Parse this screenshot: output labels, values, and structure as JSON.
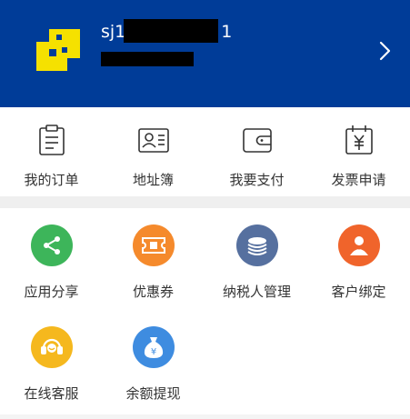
{
  "profile": {
    "username": "sj1",
    "username_suffix": "1",
    "phone": "",
    "colors": {
      "header_bg": "#003C98",
      "logo": "#F5E100"
    }
  },
  "quick_actions": [
    {
      "label": "我的订单",
      "icon": "clipboard-icon"
    },
    {
      "label": "地址簿",
      "icon": "contact-card-icon"
    },
    {
      "label": "我要支付",
      "icon": "wallet-icon"
    },
    {
      "label": "发票申请",
      "icon": "invoice-calendar-icon"
    }
  ],
  "services": [
    {
      "label": "应用分享",
      "icon": "share-icon",
      "color": "#3DB55A"
    },
    {
      "label": "优惠券",
      "icon": "coupon-icon",
      "color": "#F58A2C"
    },
    {
      "label": "纳税人管理",
      "icon": "coins-icon",
      "color": "#56709F"
    },
    {
      "label": "客户绑定",
      "icon": "user-bind-icon",
      "color": "#F0642B"
    },
    {
      "label": "在线客服",
      "icon": "headset-icon",
      "color": "#F5B81E"
    },
    {
      "label": "余额提现",
      "icon": "money-bag-icon",
      "color": "#3E8CE0"
    }
  ]
}
